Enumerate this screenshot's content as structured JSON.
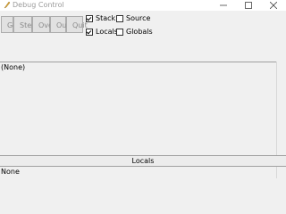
{
  "window": {
    "title": "Debug Control",
    "icon": "feather-icon",
    "controls": {
      "minimize": "minimize-icon",
      "maximize": "maximize-icon",
      "close": "close-icon"
    }
  },
  "toolbar": {
    "go": "Go",
    "step": "Step",
    "over": "Over",
    "out": "Out",
    "quit": "Quit"
  },
  "options": {
    "stack": {
      "label": "Stack",
      "checked": true
    },
    "source": {
      "label": "Source",
      "checked": false
    },
    "locals": {
      "label": "Locals",
      "checked": true
    },
    "globals": {
      "label": "Globals",
      "checked": false
    }
  },
  "stack_panel": {
    "text": "(None)"
  },
  "locals_panel": {
    "title": "Locals",
    "text": "None"
  }
}
